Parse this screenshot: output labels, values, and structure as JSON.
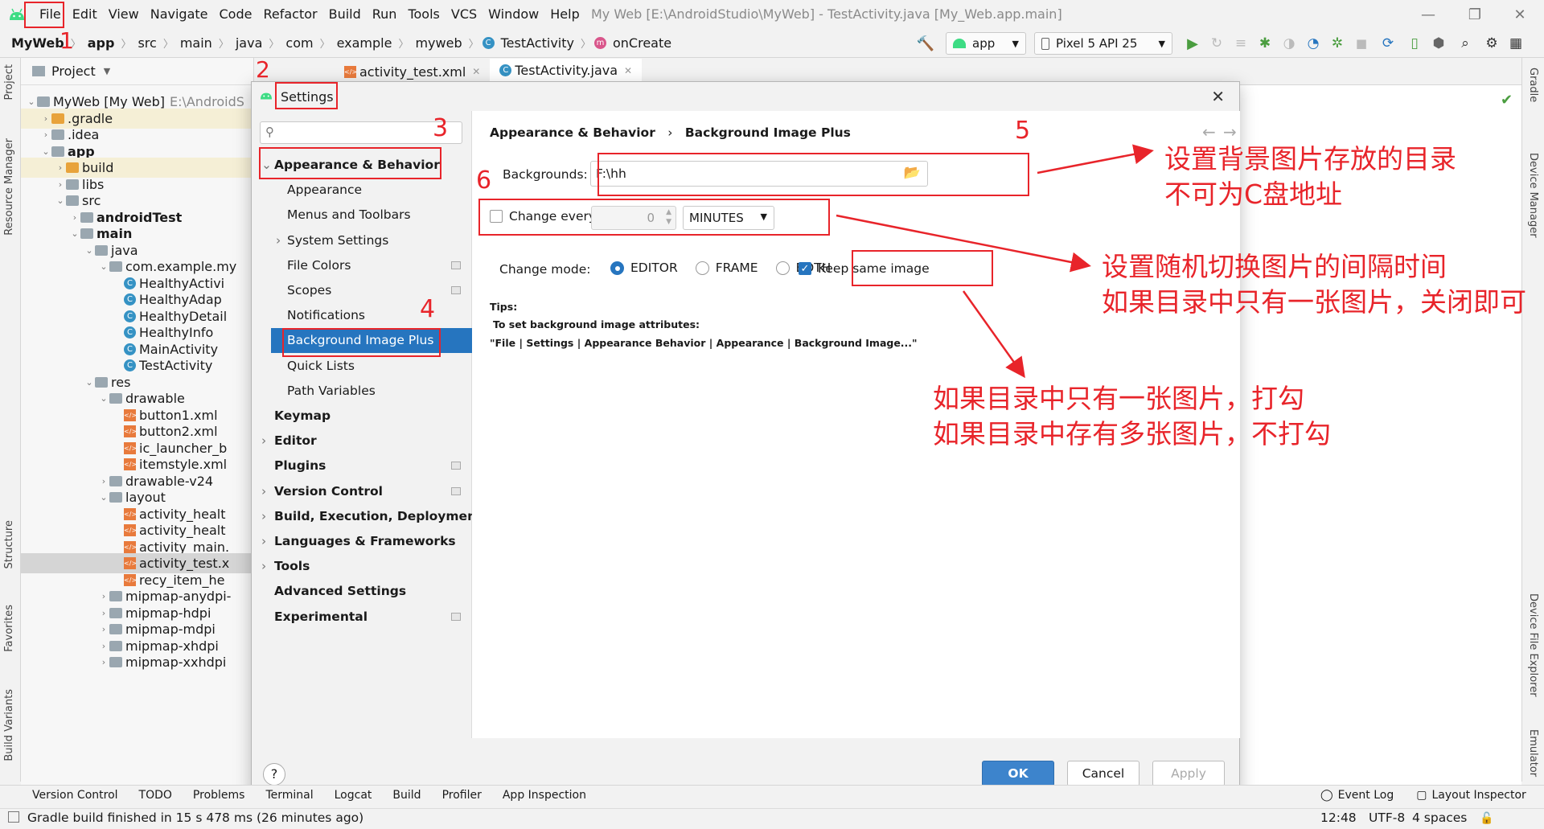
{
  "menubar": {
    "items": [
      "File",
      "Edit",
      "View",
      "Navigate",
      "Code",
      "Refactor",
      "Build",
      "Run",
      "Tools",
      "VCS",
      "Window",
      "Help"
    ],
    "window_title": "My Web [E:\\AndroidStudio\\MyWeb] - TestActivity.java [My_Web.app.main]"
  },
  "navbar": {
    "crumbs": [
      "MyWeb",
      "app",
      "src",
      "main",
      "java",
      "com",
      "example",
      "myweb",
      "TestActivity",
      "onCreate"
    ],
    "run_config": "app",
    "device": "Pixel 5 API 25"
  },
  "project_panel": {
    "title": "Project",
    "root_name": "MyWeb [My Web]",
    "root_path": "E:\\AndroidS",
    "tree": [
      {
        "label": "MyWeb [My Web]",
        "depth": 0,
        "kind": "folder"
      },
      {
        "label": ".gradle",
        "depth": 1,
        "kind": "folder-o"
      },
      {
        "label": ".idea",
        "depth": 1,
        "kind": "folder"
      },
      {
        "label": "app",
        "depth": 1,
        "kind": "folder",
        "bold": true
      },
      {
        "label": "build",
        "depth": 2,
        "kind": "folder-o"
      },
      {
        "label": "libs",
        "depth": 2,
        "kind": "folder"
      },
      {
        "label": "src",
        "depth": 2,
        "kind": "folder"
      },
      {
        "label": "androidTest",
        "depth": 3,
        "kind": "folder",
        "bold": true
      },
      {
        "label": "main",
        "depth": 3,
        "kind": "folder",
        "bold": true
      },
      {
        "label": "java",
        "depth": 4,
        "kind": "folder"
      },
      {
        "label": "com.example.my",
        "depth": 5,
        "kind": "folder"
      },
      {
        "label": "HealthyActivi",
        "depth": 6,
        "kind": "class"
      },
      {
        "label": "HealthyAdap",
        "depth": 6,
        "kind": "class"
      },
      {
        "label": "HealthyDetail",
        "depth": 6,
        "kind": "class"
      },
      {
        "label": "HealthyInfo",
        "depth": 6,
        "kind": "class"
      },
      {
        "label": "MainActivity",
        "depth": 6,
        "kind": "class"
      },
      {
        "label": "TestActivity",
        "depth": 6,
        "kind": "class"
      },
      {
        "label": "res",
        "depth": 4,
        "kind": "folder"
      },
      {
        "label": "drawable",
        "depth": 5,
        "kind": "folder"
      },
      {
        "label": "button1.xml",
        "depth": 6,
        "kind": "xml"
      },
      {
        "label": "button2.xml",
        "depth": 6,
        "kind": "xml"
      },
      {
        "label": "ic_launcher_b",
        "depth": 6,
        "kind": "xml"
      },
      {
        "label": "itemstyle.xml",
        "depth": 6,
        "kind": "xml"
      },
      {
        "label": "drawable-v24",
        "depth": 5,
        "kind": "folder"
      },
      {
        "label": "layout",
        "depth": 5,
        "kind": "folder"
      },
      {
        "label": "activity_healt",
        "depth": 6,
        "kind": "xml"
      },
      {
        "label": "activity_healt",
        "depth": 6,
        "kind": "xml"
      },
      {
        "label": "activity_main.",
        "depth": 6,
        "kind": "xml"
      },
      {
        "label": "activity_test.x",
        "depth": 6,
        "kind": "xml",
        "selected": true
      },
      {
        "label": "recy_item_he",
        "depth": 6,
        "kind": "xml"
      },
      {
        "label": "mipmap-anydpi-",
        "depth": 5,
        "kind": "folder"
      },
      {
        "label": "mipmap-hdpi",
        "depth": 5,
        "kind": "folder"
      },
      {
        "label": "mipmap-mdpi",
        "depth": 5,
        "kind": "folder"
      },
      {
        "label": "mipmap-xhdpi",
        "depth": 5,
        "kind": "folder"
      },
      {
        "label": "mipmap-xxhdpi",
        "depth": 5,
        "kind": "folder"
      }
    ]
  },
  "editor_tabs": [
    "activity_test.xml",
    "TestActivity.java"
  ],
  "left_strip": [
    "Project",
    "Resource Manager",
    "Structure",
    "Favorites",
    "Build Variants"
  ],
  "right_strip": [
    "Gradle",
    "Device Manager",
    "Device File Explorer",
    "Emulator"
  ],
  "settings": {
    "title": "Settings",
    "search_placeholder": "",
    "nav": [
      {
        "label": "Appearance & Behavior",
        "level": 0,
        "bold": true,
        "expanded": true
      },
      {
        "label": "Appearance",
        "level": 1
      },
      {
        "label": "Menus and Toolbars",
        "level": 1
      },
      {
        "label": "System Settings",
        "level": 1,
        "arrow": true
      },
      {
        "label": "File Colors",
        "level": 1,
        "grid": true
      },
      {
        "label": "Scopes",
        "level": 1,
        "grid": true
      },
      {
        "label": "Notifications",
        "level": 1
      },
      {
        "label": "Background Image Plus",
        "level": 1,
        "selected": true
      },
      {
        "label": "Quick Lists",
        "level": 1
      },
      {
        "label": "Path Variables",
        "level": 1
      },
      {
        "label": "Keymap",
        "level": 0,
        "bold": true
      },
      {
        "label": "Editor",
        "level": 0,
        "bold": true,
        "arrow": true
      },
      {
        "label": "Plugins",
        "level": 0,
        "bold": true,
        "grid": true
      },
      {
        "label": "Version Control",
        "level": 0,
        "bold": true,
        "arrow": true,
        "grid": true
      },
      {
        "label": "Build, Execution, Deployment",
        "level": 0,
        "bold": true,
        "arrow": true
      },
      {
        "label": "Languages & Frameworks",
        "level": 0,
        "bold": true,
        "arrow": true
      },
      {
        "label": "Tools",
        "level": 0,
        "bold": true,
        "arrow": true
      },
      {
        "label": "Advanced Settings",
        "level": 0,
        "bold": true
      },
      {
        "label": "Experimental",
        "level": 0,
        "bold": true,
        "grid": true
      }
    ],
    "breadcrumb_parent": "Appearance & Behavior",
    "breadcrumb_current": "Background Image Plus",
    "backgrounds_label": "Backgrounds:",
    "backgrounds_value": "F:\\hh",
    "change_every_label": "Change every:",
    "change_every_value": "0",
    "change_every_unit": "MINUTES",
    "change_every_checked": false,
    "change_mode_label": "Change mode:",
    "modes": [
      "EDITOR",
      "FRAME",
      "BOTH"
    ],
    "mode_selected": "EDITOR",
    "keep_same_label": "Keep same image",
    "keep_same_checked": true,
    "tips_title": "Tips:",
    "tips_line1": "To set background image attributes:",
    "tips_line2": "\"File | Settings | Appearance  Behavior | Appearance | Background Image...\"",
    "ok": "OK",
    "cancel": "Cancel",
    "apply": "Apply",
    "help": "?"
  },
  "annotations": {
    "numbers": [
      "1",
      "2",
      "3",
      "4",
      "5",
      "6"
    ],
    "note5_line1": "设置背景图片存放的目录",
    "note5_line2": "不可为C盘地址",
    "note6_line1": "设置随机切换图片的间隔时间",
    "note6_line2": "如果目录中只有一张图片，关闭即可",
    "note_keep_line1": "如果目录中只有一张图片，打勾",
    "note_keep_line2": "如果目录中存有多张图片，不打勾"
  },
  "bottom_tools": {
    "left": [
      "Version Control",
      "TODO",
      "Problems",
      "Terminal",
      "Logcat",
      "Build",
      "Profiler",
      "App Inspection"
    ],
    "right": [
      "Event Log",
      "Layout Inspector"
    ]
  },
  "status": {
    "message": "Gradle build finished in 15 s 478 ms (26 minutes ago)",
    "position": "12:48",
    "encoding": "UTF-8",
    "indent": "4 spaces"
  },
  "colors": {
    "accent": "#2675bf",
    "annotation": "#e8242a",
    "android_green": "#3ddc84"
  }
}
